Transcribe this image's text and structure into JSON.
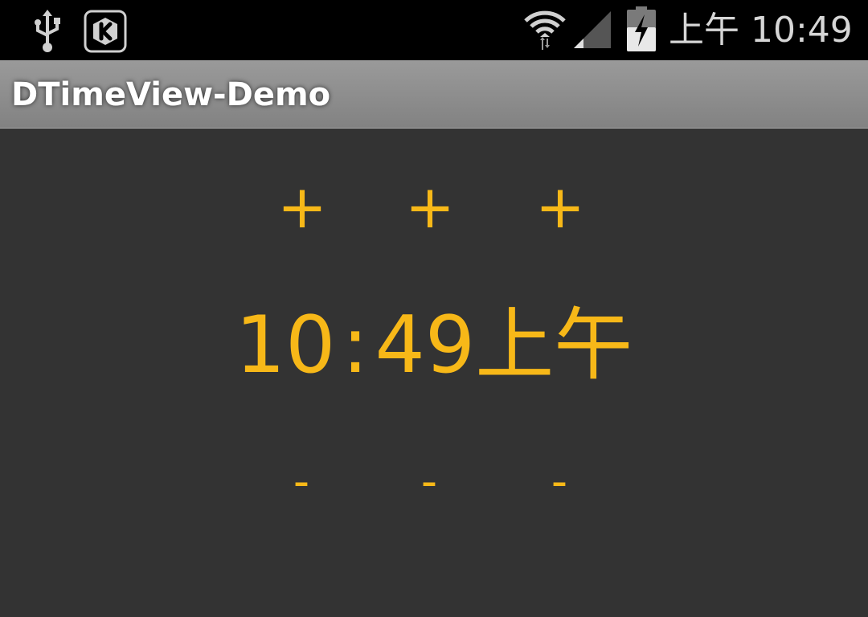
{
  "status_bar": {
    "clock": "上午 10:49",
    "icons": [
      "usb-icon",
      "k-app-icon",
      "wifi-icon",
      "cell-signal-icon",
      "battery-charging-icon"
    ]
  },
  "app": {
    "title": "DTimeView-Demo"
  },
  "time_view": {
    "hour": "10",
    "separator": ":",
    "minute": "49",
    "period": "上午",
    "increment_labels": [
      "+",
      "+",
      "+"
    ],
    "decrement_labels": [
      "-",
      "-",
      "-"
    ],
    "accent_color": "#f7b818"
  },
  "colors": {
    "background": "#333333",
    "status_bar": "#000000",
    "action_bar": "#8e8e8e"
  }
}
